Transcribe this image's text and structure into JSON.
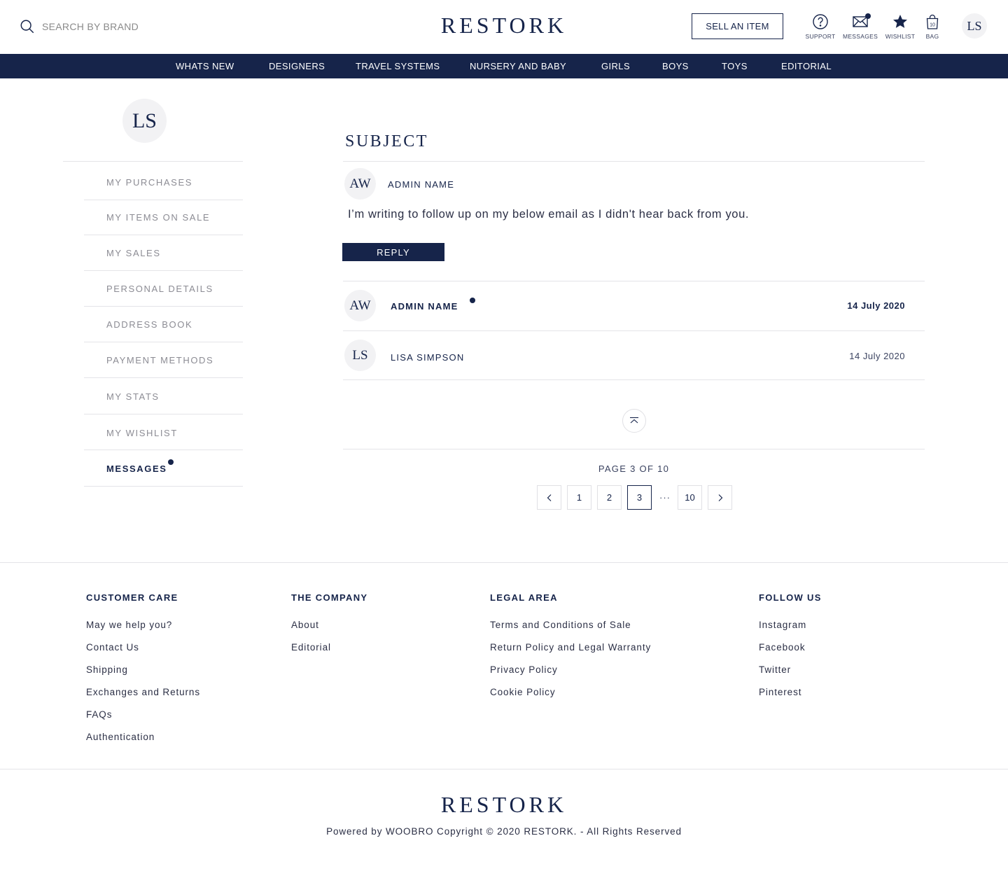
{
  "header": {
    "search_placeholder": "SEARCH BY BRAND",
    "logo": "RESTORK",
    "sell_label": "SELL AN ITEM",
    "icons": [
      {
        "name": "support",
        "label": "SUPPORT",
        "icon": "question-circle-icon"
      },
      {
        "name": "messages",
        "label": "MESSAGES",
        "icon": "envelope-icon",
        "has_notification": true
      },
      {
        "name": "wishlist",
        "label": "WISHLIST",
        "icon": "star-icon"
      },
      {
        "name": "bag",
        "label": "BAG",
        "icon": "bag-icon",
        "count": "10"
      }
    ],
    "user_initials": "LS"
  },
  "nav": {
    "items": [
      "WHATS NEW",
      "DESIGNERS",
      "TRAVEL SYSTEMS",
      "NURSERY AND BABY",
      "GIRLS",
      "BOYS",
      "TOYS",
      "EDITORIAL"
    ]
  },
  "sidebar": {
    "initials": "LS",
    "items": [
      {
        "label": "MY PURCHASES"
      },
      {
        "label": "MY ITEMS ON SALE"
      },
      {
        "label": "MY SALES"
      },
      {
        "label": "PERSONAL DETAILS"
      },
      {
        "label": "ADDRESS BOOK"
      },
      {
        "label": "PAYMENT METHODS"
      },
      {
        "label": "MY STATS"
      },
      {
        "label": "MY WISHLIST"
      },
      {
        "label": "MESSAGES",
        "active": true,
        "has_notification": true
      }
    ]
  },
  "thread": {
    "subject": "SUBJECT",
    "open_message": {
      "initials": "AW",
      "sender": "ADMIN NAME",
      "body": "I’m writing to follow up on my below email as I didn't hear back from you.",
      "reply_label": "REPLY"
    },
    "messages": [
      {
        "initials": "AW",
        "sender": "ADMIN NAME",
        "date": "14 July 2020",
        "unread": true
      },
      {
        "initials": "LS",
        "sender": "LISA SIMPSON",
        "date": "14 July 2020",
        "unread": false
      }
    ]
  },
  "pagination": {
    "label": "PAGE 3 OF 10",
    "pages": [
      "1",
      "2",
      "3",
      "10"
    ],
    "current": "3",
    "ellipsis": "···"
  },
  "footer": {
    "columns": [
      {
        "heading": "CUSTOMER CARE",
        "links": [
          "May we help you?",
          "Contact Us",
          "Shipping",
          "Exchanges and Returns",
          "FAQs",
          "Authentication"
        ]
      },
      {
        "heading": "THE COMPANY",
        "links": [
          "About",
          "Editorial"
        ]
      },
      {
        "heading": "LEGAL AREA",
        "links": [
          "Terms and Conditions of Sale",
          "Return Policy and Legal Warranty",
          "Privacy Policy",
          "Cookie Policy"
        ]
      },
      {
        "heading": "FOLLOW US",
        "links": [
          "Instagram",
          "Facebook",
          "Twitter",
          "Pinterest"
        ]
      }
    ],
    "logo": "RESTORK",
    "copyright": "Powered by WOOBRO Copyright © 2020 RESTORK. - All Rights Reserved"
  },
  "colors": {
    "brand_navy": "#16244a",
    "divider": "#e4e4e8",
    "avatar_bg": "#f2f2f4"
  }
}
